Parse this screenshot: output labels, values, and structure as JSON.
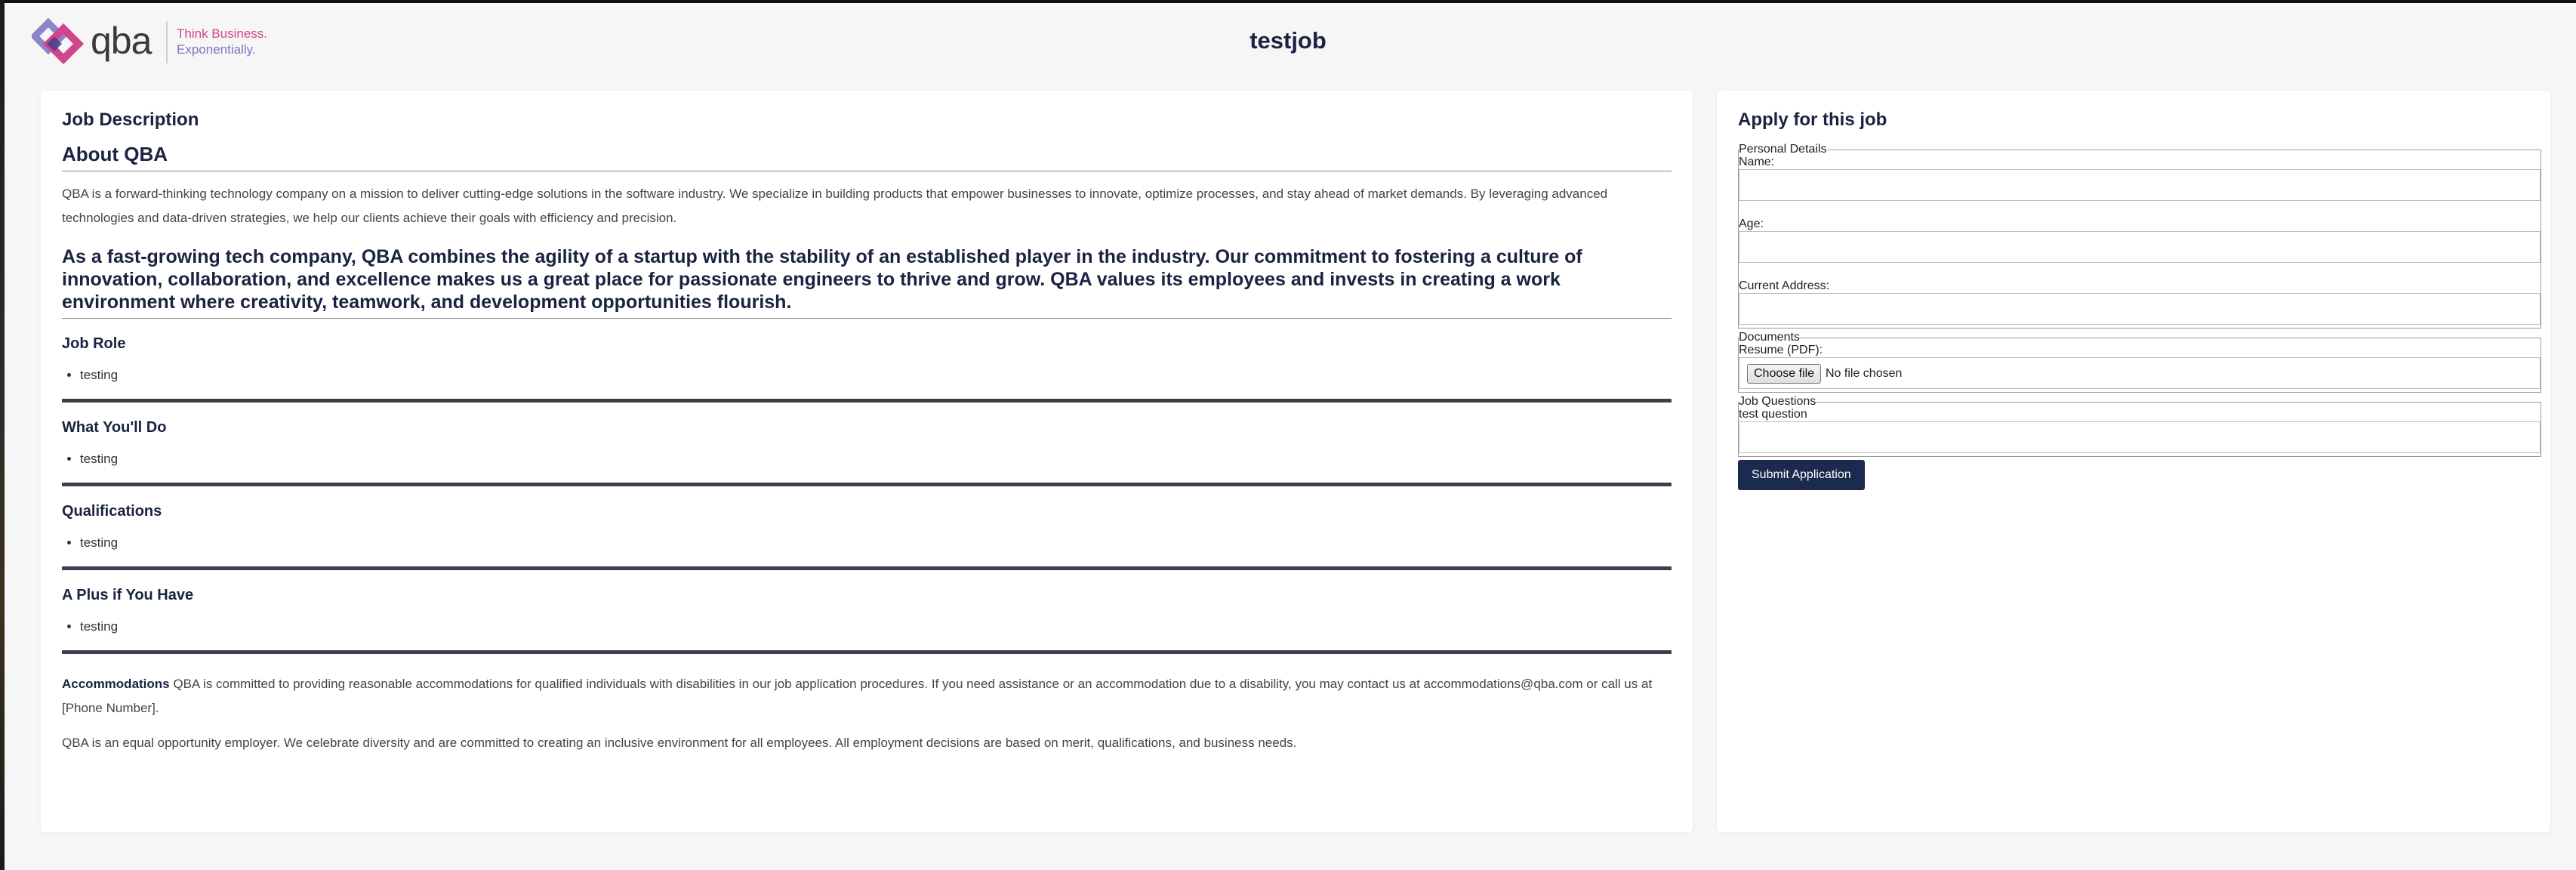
{
  "header": {
    "logo_text": "qba",
    "tagline_line1": "Think Business.",
    "tagline_line2": "Exponentially.",
    "page_title": "testjob"
  },
  "job_description": {
    "heading": "Job Description",
    "about_title": "About QBA",
    "about_body": "QBA is a forward-thinking technology company on a mission to deliver cutting-edge solutions in the software industry. We specialize in building products that empower businesses to innovate, optimize processes, and stay ahead of market demands. By leveraging advanced technologies and data-driven strategies, we help our clients achieve their goals with efficiency and precision.",
    "about_lead": "As a fast-growing tech company, QBA combines the agility of a startup with the stability of an established player in the industry. Our commitment to fostering a culture of innovation, collaboration, and excellence makes us a great place for passionate engineers to thrive and grow. QBA values its employees and invests in creating a work environment where creativity, teamwork, and development opportunities flourish.",
    "sections": [
      {
        "title": "Job Role",
        "items": [
          "testing"
        ]
      },
      {
        "title": "What You'll Do",
        "items": [
          "testing"
        ]
      },
      {
        "title": "Qualifications",
        "items": [
          "testing"
        ]
      },
      {
        "title": "A Plus if You Have",
        "items": [
          "testing"
        ]
      }
    ],
    "accommodations_label": "Accommodations",
    "accommodations_body": " QBA is committed to providing reasonable accommodations for qualified individuals with disabilities in our job application procedures. If you need assistance or an accommodation due to a disability, you may contact us at accommodations@qba.com or call us at [Phone Number].",
    "eeo_statement": "QBA is an equal opportunity employer. We celebrate diversity and are committed to creating an inclusive environment for all employees. All employment decisions are based on merit, qualifications, and business needs."
  },
  "application_form": {
    "heading": "Apply for this job",
    "personal_legend": "Personal Details",
    "name_label": "Name:",
    "name_value": "",
    "age_label": "Age:",
    "age_value": "",
    "address_label": "Current Address:",
    "address_value": "",
    "documents_legend": "Documents",
    "resume_label": "Resume (PDF):",
    "choose_file_label": "Choose file",
    "file_status": "No file chosen",
    "questions_legend": "Job Questions",
    "question_1_label": "test question",
    "question_1_value": "",
    "submit_label": "Submit Application"
  },
  "colors": {
    "brand_navy": "#1b2a4e",
    "logo_pink": "#d2448c",
    "logo_purple": "#7d74c4",
    "page_background": "#f6f6f6"
  }
}
